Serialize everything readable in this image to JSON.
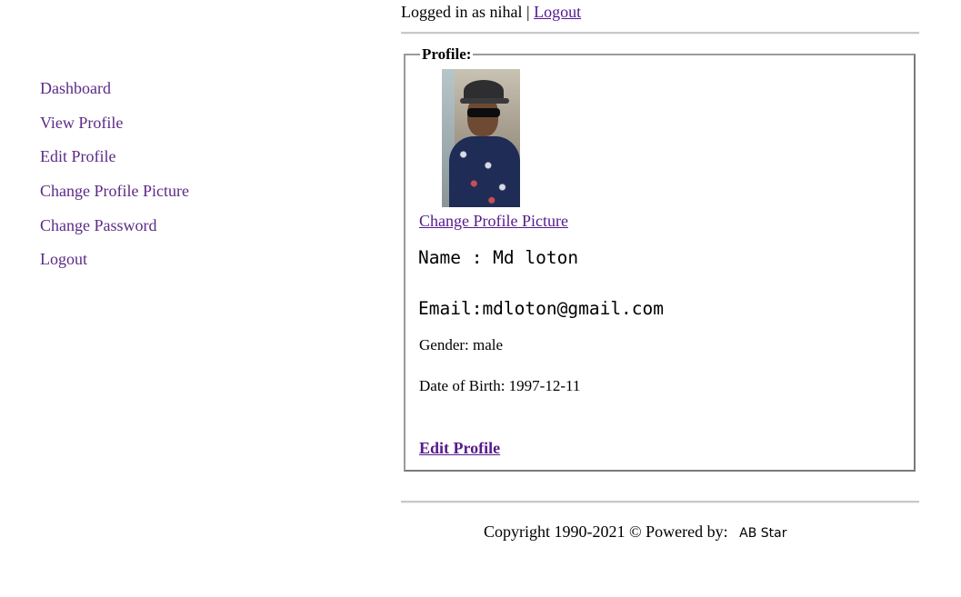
{
  "header": {
    "logged_in_text": "Logged in as nihal |",
    "logout_label": "Logout"
  },
  "sidebar": {
    "items": [
      {
        "label": "Dashboard"
      },
      {
        "label": "View Profile"
      },
      {
        "label": "Edit Profile"
      },
      {
        "label": "Change Profile Picture"
      },
      {
        "label": "Change Password"
      },
      {
        "label": "Logout"
      }
    ]
  },
  "profile": {
    "legend": "Profile:",
    "change_picture_label": "Change Profile Picture",
    "name_line": "Name : Md loton",
    "email_line": "Email:mdloton@gmail.com",
    "gender_line": "Gender: male",
    "dob_line": "Date of Birth: 1997-12-11",
    "edit_label": "Edit Profile"
  },
  "footer": {
    "copyright": "Copyright 1990-2021 © Powered by:",
    "brand": "AB Star"
  },
  "colors": {
    "link": "#551a8b",
    "nav_link": "#5b2a86",
    "rule": "#c8c8c8",
    "fieldset_border": "#9a9a9a"
  }
}
